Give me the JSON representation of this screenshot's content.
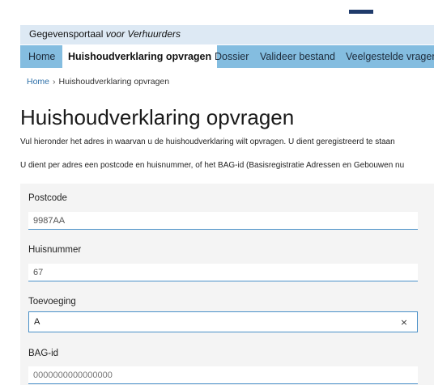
{
  "header": {
    "portal_name": "Gegevensportaal",
    "portal_sub": "voor Verhuurders"
  },
  "nav": {
    "items": [
      {
        "label": "Home"
      },
      {
        "label": "Huishoudverklaring opvragen"
      },
      {
        "label": "Dossier"
      },
      {
        "label": "Valideer bestand"
      },
      {
        "label": "Veelgestelde vragen"
      }
    ]
  },
  "breadcrumb": {
    "home": "Home",
    "separator": "›",
    "current": "Huishoudverklaring opvragen"
  },
  "page": {
    "title": "Huishoudverklaring opvragen",
    "intro_1": "Vul hieronder het adres in waarvan u de huishoudverklaring wilt opvragen. U dient geregistreerd te staan",
    "intro_2": "U dient per adres een postcode en huisnummer, of het BAG-id (Basisregistratie Adressen en Gebouwen nu"
  },
  "form": {
    "postcode": {
      "label": "Postcode",
      "value": "9987AA"
    },
    "huisnummer": {
      "label": "Huisnummer",
      "value": "67"
    },
    "toevoeging": {
      "label": "Toevoeging",
      "value": "A",
      "clear": "×"
    },
    "bag_id": {
      "label": "BAG-id",
      "placeholder": "0000000000000000"
    }
  }
}
